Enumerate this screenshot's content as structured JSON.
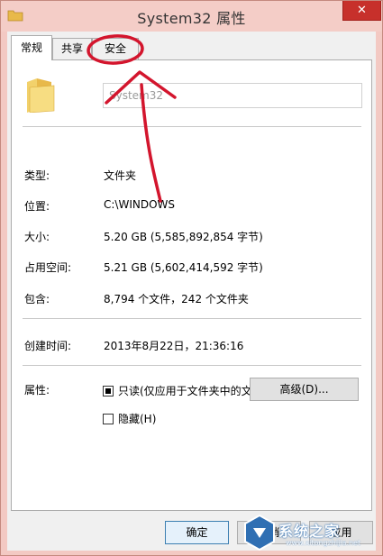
{
  "window": {
    "title": "System32 属性",
    "close_glyph": "✕"
  },
  "tabs": [
    {
      "label": "常规",
      "active": true
    },
    {
      "label": "共享",
      "active": false
    },
    {
      "label": "安全",
      "active": false
    }
  ],
  "general": {
    "name_value": "System32",
    "rows": [
      {
        "label": "类型:",
        "value": "文件夹"
      },
      {
        "label": "位置:",
        "value": "C:\\WINDOWS"
      },
      {
        "label": "大小:",
        "value": "5.20 GB (5,585,892,854 字节)"
      },
      {
        "label": "占用空间:",
        "value": "5.21 GB (5,602,414,592 字节)"
      },
      {
        "label": "包含:",
        "value": "8,794 个文件，242 个文件夹"
      }
    ],
    "created": {
      "label": "创建时间:",
      "value": "2013年8月22日，21:36:16"
    },
    "attributes": {
      "label": "属性:",
      "readonly": {
        "label": "只读(仅应用于文件夹中的文件)(R)",
        "state": "indeterminate"
      },
      "hidden": {
        "label": "隐藏(H)",
        "state": "unchecked"
      },
      "advanced_button": "高级(D)..."
    }
  },
  "buttons": {
    "ok": "确定",
    "cancel": "取消",
    "apply": "应用"
  },
  "watermark": {
    "text": "系统之家",
    "url": "www.xitongzhijia.net"
  },
  "colors": {
    "titlebar": "#f4cdc7",
    "close_button": "#c7302b",
    "annotation": "#d3152d",
    "folder": "#f2c94c"
  }
}
